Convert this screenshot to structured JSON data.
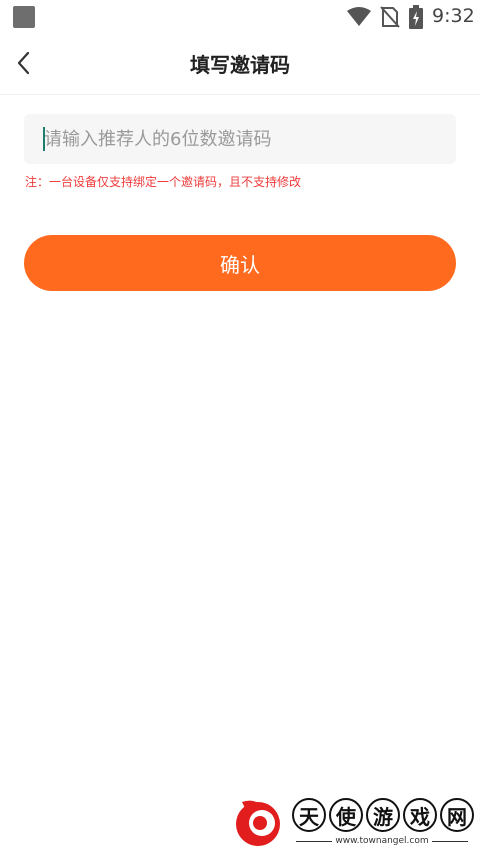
{
  "status_bar": {
    "time": "9:32",
    "icons": [
      "app-notification-icon",
      "wifi-icon",
      "no-sim-icon",
      "battery-charging-icon"
    ]
  },
  "header": {
    "title": "填写邀请码",
    "back_icon": "chevron-left-icon"
  },
  "form": {
    "input_placeholder": "请输入推荐人的6位数邀请码",
    "input_value": "",
    "note": "注：一台设备仅支持绑定一个邀请码，且不支持修改",
    "confirm_label": "确认"
  },
  "watermark": {
    "chars": [
      "天",
      "使",
      "游",
      "戏",
      "网"
    ],
    "url": "www.townangel.com"
  },
  "colors": {
    "accent": "#ff6a1f",
    "note_text": "#ee3b3b",
    "input_bg": "#f6f6f6",
    "caret": "#1f7d6b"
  }
}
